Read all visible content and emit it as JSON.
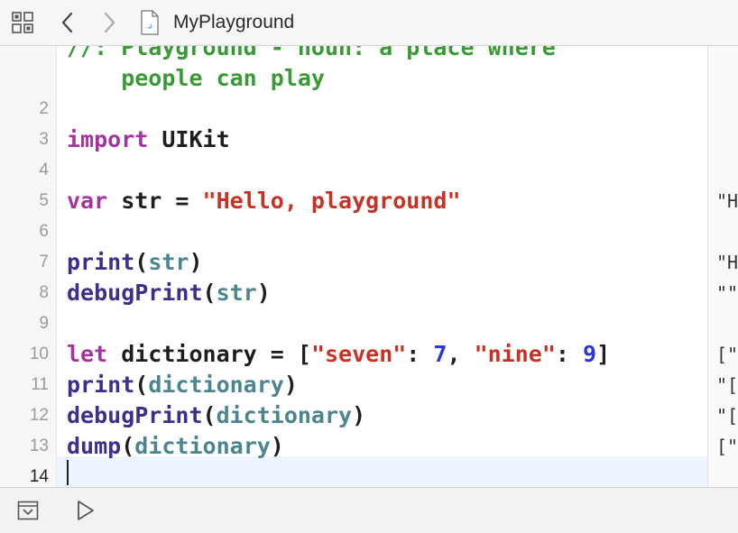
{
  "toolbar": {
    "filename": "MyPlayground",
    "icons": [
      "related-items-grid-icon",
      "chevron-left-icon",
      "chevron-right-icon",
      "swift-file-icon"
    ]
  },
  "editor": {
    "lines": [
      {
        "num": "",
        "tokens": [
          {
            "t": "//: Playground - noun: a place where",
            "c": "cm"
          }
        ],
        "result": ""
      },
      {
        "num": "",
        "tokens": [
          {
            "t": "    people can play",
            "c": "cm"
          }
        ],
        "result": ""
      },
      {
        "num": "2",
        "tokens": [],
        "result": ""
      },
      {
        "num": "3",
        "tokens": [
          {
            "t": "import",
            "c": "kw"
          },
          {
            "t": " UIKit",
            "c": "pl"
          }
        ],
        "result": ""
      },
      {
        "num": "4",
        "tokens": [],
        "result": ""
      },
      {
        "num": "5",
        "tokens": [
          {
            "t": "var",
            "c": "kw"
          },
          {
            "t": " str = ",
            "c": "pl"
          },
          {
            "t": "\"Hello, playground\"",
            "c": "str"
          }
        ],
        "result": "\"H"
      },
      {
        "num": "6",
        "tokens": [],
        "result": ""
      },
      {
        "num": "7",
        "tokens": [
          {
            "t": "print",
            "c": "fn"
          },
          {
            "t": "(",
            "c": "pl"
          },
          {
            "t": "str",
            "c": "id"
          },
          {
            "t": ")",
            "c": "pl"
          }
        ],
        "result": "\"H"
      },
      {
        "num": "8",
        "tokens": [
          {
            "t": "debugPrint",
            "c": "fn"
          },
          {
            "t": "(",
            "c": "pl"
          },
          {
            "t": "str",
            "c": "id"
          },
          {
            "t": ")",
            "c": "pl"
          }
        ],
        "result": "\"\""
      },
      {
        "num": "9",
        "tokens": [],
        "result": ""
      },
      {
        "num": "10",
        "tokens": [
          {
            "t": "let",
            "c": "kw"
          },
          {
            "t": " dictionary = [",
            "c": "pl"
          },
          {
            "t": "\"seven\"",
            "c": "str"
          },
          {
            "t": ": ",
            "c": "pl"
          },
          {
            "t": "7",
            "c": "num"
          },
          {
            "t": ", ",
            "c": "pl"
          },
          {
            "t": "\"nine\"",
            "c": "str"
          },
          {
            "t": ": ",
            "c": "pl"
          },
          {
            "t": "9",
            "c": "num"
          },
          {
            "t": "]",
            "c": "pl"
          }
        ],
        "result": "[\""
      },
      {
        "num": "11",
        "tokens": [
          {
            "t": "print",
            "c": "fn"
          },
          {
            "t": "(",
            "c": "pl"
          },
          {
            "t": "dictionary",
            "c": "id"
          },
          {
            "t": ")",
            "c": "pl"
          }
        ],
        "result": "\"["
      },
      {
        "num": "12",
        "tokens": [
          {
            "t": "debugPrint",
            "c": "fn"
          },
          {
            "t": "(",
            "c": "pl"
          },
          {
            "t": "dictionary",
            "c": "id"
          },
          {
            "t": ")",
            "c": "pl"
          }
        ],
        "result": "\"["
      },
      {
        "num": "13",
        "tokens": [
          {
            "t": "dump",
            "c": "fn"
          },
          {
            "t": "(",
            "c": "pl"
          },
          {
            "t": "dictionary",
            "c": "id"
          },
          {
            "t": ")",
            "c": "pl"
          }
        ],
        "result": "[\""
      },
      {
        "num": "14",
        "tokens": [],
        "result": "",
        "current": true
      }
    ]
  },
  "bottombar": {
    "icons": [
      "hide-debug-area-icon",
      "run-playground-icon"
    ]
  },
  "colors": {
    "keyword": "#a3359d",
    "string": "#c53226",
    "function": "#3f2e8c",
    "identifier": "#4b858f",
    "number": "#2c37d3",
    "comment": "#3a9a36",
    "current_line": "#eef4fd"
  }
}
